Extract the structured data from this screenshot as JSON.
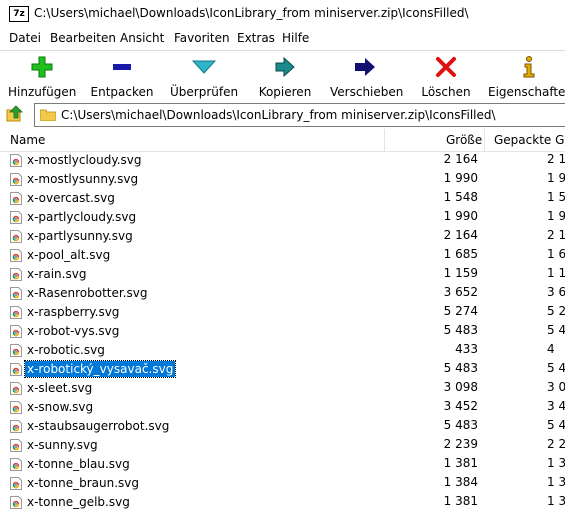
{
  "window": {
    "app_icon_text": "7z",
    "title": "C:\\Users\\michael\\Downloads\\IconLibrary_from miniserver.zip\\IconsFilled\\"
  },
  "menu": [
    "Datei",
    "Bearbeiten",
    "Ansicht",
    "Favoriten",
    "Extras",
    "Hilfe"
  ],
  "toolbar": {
    "add": "Hinzufügen",
    "extract": "Entpacken",
    "test": "Überprüfen",
    "copy": "Kopieren",
    "move": "Verschieben",
    "delete": "Löschen",
    "properties": "Eigenschaften"
  },
  "address": {
    "path": "C:\\Users\\michael\\Downloads\\IconLibrary_from miniserver.zip\\IconsFilled\\"
  },
  "columns": {
    "name": "Name",
    "size": "Größe",
    "packed": "Gepackte Größe"
  },
  "files": [
    {
      "name": "x-mostlycloudy.svg",
      "size": "2 164",
      "packed": "2 1"
    },
    {
      "name": "x-mostlysunny.svg",
      "size": "1 990",
      "packed": "1 9"
    },
    {
      "name": "x-overcast.svg",
      "size": "1 548",
      "packed": "1 5"
    },
    {
      "name": "x-partlycloudy.svg",
      "size": "1 990",
      "packed": "1 9"
    },
    {
      "name": "x-partlysunny.svg",
      "size": "2 164",
      "packed": "2 1"
    },
    {
      "name": "x-pool_alt.svg",
      "size": "1 685",
      "packed": "1 6"
    },
    {
      "name": "x-rain.svg",
      "size": "1 159",
      "packed": "1 1"
    },
    {
      "name": "x-Rasenrobotter.svg",
      "size": "3 652",
      "packed": "3 6"
    },
    {
      "name": "x-raspberry.svg",
      "size": "5 274",
      "packed": "5 2"
    },
    {
      "name": "x-robot-vys.svg",
      "size": "5 483",
      "packed": "5 4"
    },
    {
      "name": "x-robotic.svg",
      "size": "433",
      "packed": "4"
    },
    {
      "name": "x-robotický_vysavač.svg",
      "size": "5 483",
      "packed": "5 4",
      "selected": true
    },
    {
      "name": "x-sleet.svg",
      "size": "3 098",
      "packed": "3 0"
    },
    {
      "name": "x-snow.svg",
      "size": "3 452",
      "packed": "3 4"
    },
    {
      "name": "x-staubsaugerrobot.svg",
      "size": "5 483",
      "packed": "5 4"
    },
    {
      "name": "x-sunny.svg",
      "size": "2 239",
      "packed": "2 2"
    },
    {
      "name": "x-tonne_blau.svg",
      "size": "1 381",
      "packed": "1 3"
    },
    {
      "name": "x-tonne_braun.svg",
      "size": "1 384",
      "packed": "1 3"
    },
    {
      "name": "x-tonne_gelb.svg",
      "size": "1 381",
      "packed": "1 3"
    }
  ],
  "colors": {
    "selection": "#0078d7",
    "add": "#1fbf1f",
    "extract": "#1a1aa8",
    "test": "#2fb5c8",
    "copy": "#1a8a8a",
    "move": "#101070",
    "delete": "#e01010",
    "properties": "#e0b000"
  },
  "icons": {
    "file": "chrome-svg-file-icon",
    "up": "folder-up-icon",
    "folder": "folder-icon"
  }
}
